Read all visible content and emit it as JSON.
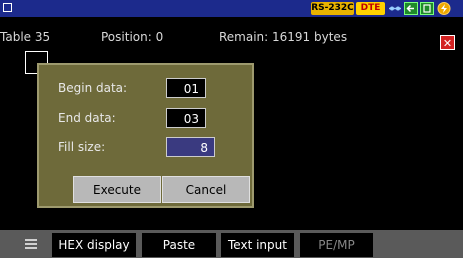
{
  "status": {
    "rs232_label": "RS-232C",
    "dte_label": "DTE"
  },
  "info": {
    "table": "Table 35",
    "position": "Position: 0",
    "remain": "Remain: 16191 bytes"
  },
  "dialog": {
    "begin_label": "Begin data:",
    "begin_value": "01",
    "end_label": "End data:",
    "end_value": "03",
    "fill_label": "Fill size:",
    "fill_value": "8",
    "execute_label": "Execute",
    "cancel_label": "Cancel"
  },
  "toolbar": {
    "hex_label": "HEX display",
    "paste_label": "Paste",
    "text_label": "Text input",
    "pemp_label": "PE/MP"
  },
  "colors": {
    "status_bar": "#1c2a8c",
    "dialog_bg": "#6e6a3a",
    "badge_rs232": "#e8b200",
    "badge_dte": "#ffd200",
    "close": "#d32222"
  },
  "icons": [
    "window-square-icon",
    "connection-icon",
    "arrow-icon",
    "storage-icon",
    "power-icon",
    "close-icon",
    "menu-icon"
  ]
}
